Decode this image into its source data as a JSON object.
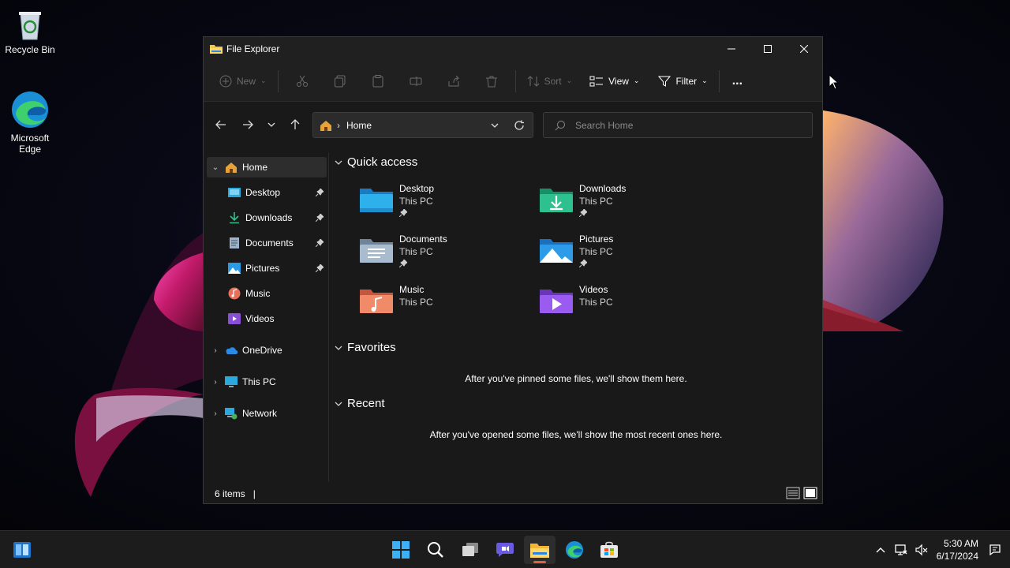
{
  "desktop": {
    "icons": [
      {
        "label": "Recycle Bin",
        "icon": "recycle-bin-icon"
      },
      {
        "label": "Microsoft Edge",
        "icon": "edge-icon"
      }
    ]
  },
  "window": {
    "title": "File Explorer",
    "controls": {
      "minimize": "minimize-icon",
      "maximize": "maximize-icon",
      "close": "close-icon"
    }
  },
  "toolbar": {
    "new_label": "New",
    "sort_label": "Sort",
    "view_label": "View",
    "filter_label": "Filter",
    "more_label": "..."
  },
  "address": {
    "location": "Home",
    "search_placeholder": "Search Home"
  },
  "sidebar": {
    "items": [
      {
        "label": "Home",
        "icon": "home-icon"
      },
      {
        "label": "Desktop",
        "icon": "desktop-folder-icon",
        "pinned": true
      },
      {
        "label": "Downloads",
        "icon": "downloads-icon",
        "pinned": true
      },
      {
        "label": "Documents",
        "icon": "documents-icon",
        "pinned": true
      },
      {
        "label": "Pictures",
        "icon": "pictures-icon",
        "pinned": true
      },
      {
        "label": "Music",
        "icon": "music-icon"
      },
      {
        "label": "Videos",
        "icon": "videos-icon"
      },
      {
        "label": "OneDrive",
        "icon": "onedrive-icon"
      },
      {
        "label": "This PC",
        "icon": "this-pc-icon"
      },
      {
        "label": "Network",
        "icon": "network-icon"
      }
    ]
  },
  "content": {
    "quick_access": {
      "heading": "Quick access",
      "items": [
        {
          "name": "Desktop",
          "location": "This PC",
          "pinned": true
        },
        {
          "name": "Downloads",
          "location": "This PC",
          "pinned": true
        },
        {
          "name": "Documents",
          "location": "This PC",
          "pinned": true
        },
        {
          "name": "Pictures",
          "location": "This PC",
          "pinned": true
        },
        {
          "name": "Music",
          "location": "This PC",
          "pinned": false
        },
        {
          "name": "Videos",
          "location": "This PC",
          "pinned": false
        }
      ]
    },
    "favorites": {
      "heading": "Favorites",
      "empty_message": "After you've pinned some files, we'll show them here."
    },
    "recent": {
      "heading": "Recent",
      "empty_message": "After you've opened some files, we'll show the most recent ones here."
    }
  },
  "status": {
    "item_count": "6 items",
    "caret": "|"
  },
  "taskbar": {
    "apps": [
      "windows-logo-icon",
      "search-icon",
      "task-view-icon",
      "chat-icon",
      "file-explorer-icon",
      "edge-icon",
      "store-icon"
    ],
    "time": "5:30 AM",
    "date": "6/17/2024"
  },
  "colors": {
    "window_bg": "#191919",
    "toolbar_bg": "#202020",
    "taskbar_bg": "#1c1c1c",
    "accent_blue": "#4cc2ff"
  }
}
